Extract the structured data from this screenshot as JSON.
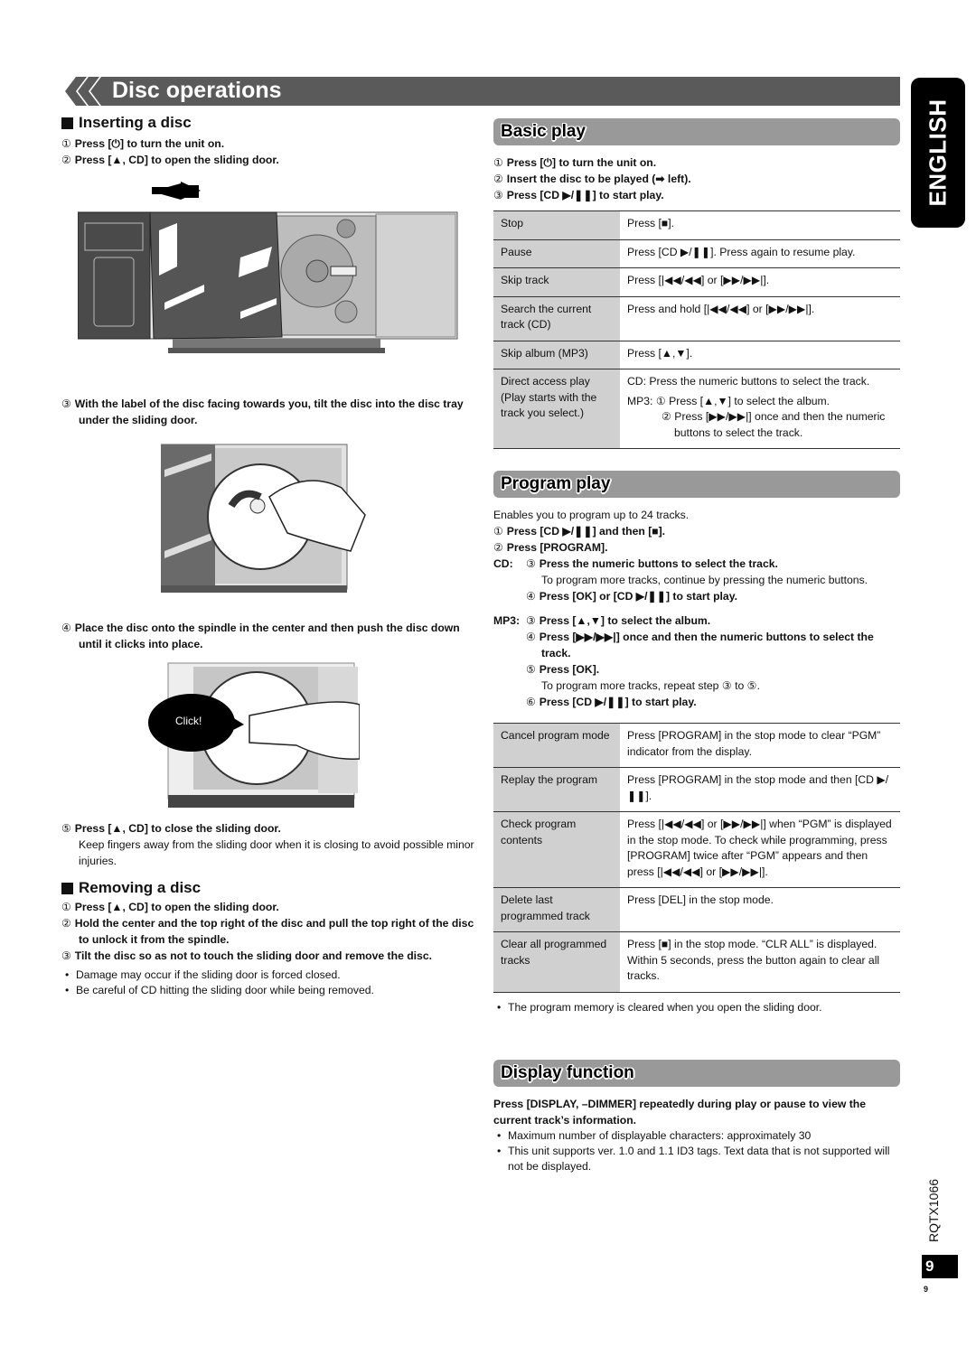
{
  "page_title": "Disc operations",
  "language_tab": "ENGLISH",
  "doc_code": "RQTX1066",
  "page_number": "9",
  "page_number_small": "9",
  "inserting": {
    "heading": "Inserting a disc",
    "steps": [
      {
        "num": "①",
        "text": "Press [⏻] to turn the unit on."
      },
      {
        "num": "②",
        "text": "Press [▲, CD] to open the sliding door."
      },
      {
        "num": "③",
        "text": "With the label of the disc facing towards you, tilt the disc into the disc tray under the sliding door."
      },
      {
        "num": "④",
        "text": "Place the disc onto the spindle in the center and then push the disc down until it clicks into place."
      },
      {
        "num": "⑤",
        "text": "Press [▲, CD] to close the sliding door."
      }
    ],
    "step5_note": "Keep fingers away from the sliding door when it is closing to avoid possible minor injuries.",
    "click_label": "Click!"
  },
  "removing": {
    "heading": "Removing a disc",
    "steps": [
      {
        "num": "①",
        "text": "Press [▲, CD] to open the sliding door."
      },
      {
        "num": "②",
        "text": "Hold the center and the top right of the disc and pull the top right of the disc to unlock it from the spindle."
      },
      {
        "num": "③",
        "text": "Tilt the disc so as not to touch the sliding door and remove the disc."
      }
    ],
    "bullets": [
      "Damage may occur if the sliding door is forced closed.",
      "Be careful of CD hitting the sliding door while being removed."
    ]
  },
  "basic_play": {
    "heading": "Basic play",
    "steps": [
      {
        "num": "①",
        "text": "Press [⏻] to turn the unit on."
      },
      {
        "num": "②",
        "text": "Insert the disc to be played (➡ left)."
      },
      {
        "num": "③",
        "text": "Press [CD ▶/❚❚] to start play."
      }
    ],
    "table": [
      {
        "key": "Stop",
        "value": "Press [■]."
      },
      {
        "key": "Pause",
        "value": "Press [CD ▶/❚❚]. Press again to resume play."
      },
      {
        "key": "Skip track",
        "value": "Press [|◀◀/◀◀] or [▶▶/▶▶|]."
      },
      {
        "key": "Search the current track (CD)",
        "value": "Press and hold [|◀◀/◀◀] or [▶▶/▶▶|]."
      },
      {
        "key": "Skip album (MP3)",
        "value": "Press [▲,▼]."
      },
      {
        "key": "Direct access play (Play starts with the track you select.)",
        "value_cd": "CD: Press the numeric buttons to select the track.",
        "value_mp3_1": "MP3: ① Press [▲,▼] to select the album.",
        "value_mp3_2": "② Press [▶▶/▶▶|] once and then the numeric buttons to select the track."
      }
    ]
  },
  "program_play": {
    "heading": "Program play",
    "intro": "Enables you to program up to 24 tracks.",
    "steps": [
      {
        "num": "①",
        "text": "Press [CD ▶/❚❚] and then [■]."
      },
      {
        "num": "②",
        "text": "Press [PROGRAM]."
      }
    ],
    "cd_label": "CD:",
    "cd_steps": [
      {
        "num": "③",
        "text": "Press the numeric buttons to select the track."
      },
      {
        "num": "④",
        "text": "Press [OK] or [CD ▶/❚❚] to start play."
      }
    ],
    "cd_note": "To program more tracks, continue by pressing the numeric buttons.",
    "mp3_label": "MP3:",
    "mp3_steps": [
      {
        "num": "③",
        "text": "Press [▲,▼] to select the album."
      },
      {
        "num": "④",
        "text": "Press [▶▶/▶▶|] once and then the numeric buttons to select the track."
      },
      {
        "num": "⑤",
        "text": "Press [OK]."
      },
      {
        "num": "⑥",
        "text": "Press [CD ▶/❚❚] to start play."
      }
    ],
    "mp3_note": "To program more tracks, repeat step ③ to ⑤.",
    "table": [
      {
        "key": "Cancel program mode",
        "value": "Press [PROGRAM] in the stop mode to clear “PGM” indicator from the display."
      },
      {
        "key": "Replay the program",
        "value": "Press [PROGRAM] in the stop mode and then [CD ▶/❚❚]."
      },
      {
        "key": "Check program contents",
        "value": "Press [|◀◀/◀◀] or [▶▶/▶▶|] when “PGM” is displayed in the stop mode. To check while programming, press [PROGRAM] twice after “PGM” appears and then press [|◀◀/◀◀] or [▶▶/▶▶|]."
      },
      {
        "key": "Delete last programmed track",
        "value": "Press [DEL] in the stop mode."
      },
      {
        "key": "Clear all programmed tracks",
        "value": "Press [■] in the stop mode. “CLR ALL” is displayed. Within 5 seconds, press the button again to clear all tracks."
      }
    ],
    "note": "The program memory is cleared when you open the sliding door."
  },
  "display_function": {
    "heading": "Display function",
    "instruction": "Press [DISPLAY, –DIMMER] repeatedly during play or pause to view the current track’s information.",
    "bullets": [
      "Maximum number of displayable characters: approximately 30",
      "This unit supports ver. 1.0 and 1.1 ID3 tags. Text data that is not supported will not be displayed."
    ]
  }
}
